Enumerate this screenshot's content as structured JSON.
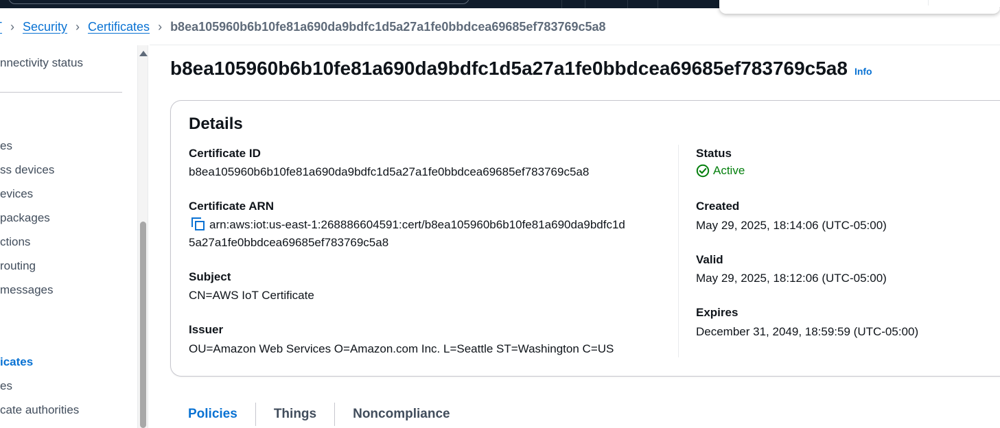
{
  "breadcrumb": {
    "root_fragment": "T",
    "items": [
      "Security",
      "Certificates"
    ],
    "current": "b8ea105960b6b10fe81a690da9bdfc1d5a27a1fe0bbdcea69685ef783769c5a8"
  },
  "sidebar": {
    "top_item": "nnectivity status",
    "items": [
      "es",
      "ss devices",
      "evices",
      " packages",
      "ctions",
      "routing",
      " messages"
    ],
    "active_item": "icates",
    "bottom_items": [
      "es",
      "cate authorities"
    ]
  },
  "page": {
    "title": "b8ea105960b6b10fe81a690da9bdfc1d5a27a1fe0bbdcea69685ef783769c5a8",
    "info_link": "Info"
  },
  "details": {
    "heading": "Details",
    "certificate_id_label": "Certificate ID",
    "certificate_id": "b8ea105960b6b10fe81a690da9bdfc1d5a27a1fe0bbdcea69685ef783769c5a8",
    "certificate_arn_label": "Certificate ARN",
    "certificate_arn_line1": "arn:aws:iot:us-east-1:268886604591:cert/b8ea105960b6b10fe81a690da9bdfc1d",
    "certificate_arn_line2": "5a27a1fe0bbdcea69685ef783769c5a8",
    "subject_label": "Subject",
    "subject": "CN=AWS IoT Certificate",
    "issuer_label": "Issuer",
    "issuer": "OU=Amazon Web Services O=Amazon.com Inc. L=Seattle ST=Washington C=US",
    "status_label": "Status",
    "status": "Active",
    "created_label": "Created",
    "created": "May 29, 2025, 18:14:06 (UTC-05:00)",
    "valid_label": "Valid",
    "valid": "May 29, 2025, 18:12:06 (UTC-05:00)",
    "expires_label": "Expires",
    "expires": "December 31, 2049, 18:59:59 (UTC-05:00)"
  },
  "tabs": [
    "Policies",
    "Things",
    "Noncompliance"
  ],
  "colors": {
    "link": "#0972d3",
    "success": "#037f0c",
    "topbar": "#0f1b2a",
    "border": "#c6c6cd"
  },
  "icons": {
    "copy": "copy-icon",
    "status": "check-circle-icon",
    "breadcrumb_separator": "chevron-right-icon",
    "scroll_up": "caret-up-icon"
  }
}
